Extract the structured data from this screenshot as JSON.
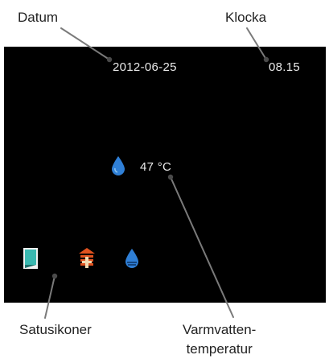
{
  "callouts": {
    "date": "Datum",
    "clock": "Klocka",
    "status_icons": "Satusikoner",
    "hot_water_line1": "Varmvatten-",
    "hot_water_line2": "temperatur"
  },
  "display": {
    "date": "2012-06-25",
    "time": "08.15",
    "hot_water_temp": "47 °C"
  },
  "icons": {
    "main": "water-drop-icon",
    "status": [
      "handbook-icon",
      "heat-pump-icon",
      "water-drop-icon"
    ]
  },
  "colors": {
    "screen_background": "#000000",
    "screen_text": "#e9e9e9",
    "drop_blue": "#2f7fd6",
    "heat_orange": "#e0521f",
    "book_teal": "#3ab8b0"
  }
}
